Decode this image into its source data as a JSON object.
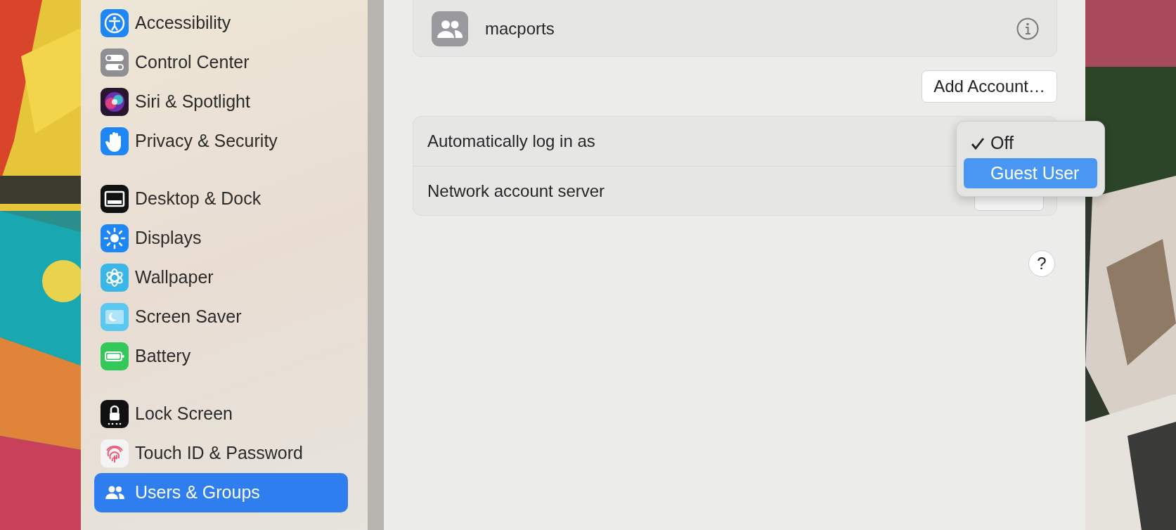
{
  "sidebar": {
    "groups": [
      {
        "items": [
          {
            "label": "Accessibility",
            "selected": false
          },
          {
            "label": "Control Center",
            "selected": false
          },
          {
            "label": "Siri & Spotlight",
            "selected": false
          },
          {
            "label": "Privacy & Security",
            "selected": false
          }
        ]
      },
      {
        "items": [
          {
            "label": "Desktop & Dock",
            "selected": false
          },
          {
            "label": "Displays",
            "selected": false
          },
          {
            "label": "Wallpaper",
            "selected": false
          },
          {
            "label": "Screen Saver",
            "selected": false
          },
          {
            "label": "Battery",
            "selected": false
          }
        ]
      },
      {
        "items": [
          {
            "label": "Lock Screen",
            "selected": false
          },
          {
            "label": "Touch ID & Password",
            "selected": false
          },
          {
            "label": "Users & Groups",
            "selected": true
          }
        ]
      }
    ]
  },
  "accounts": [
    {
      "name": "macports"
    }
  ],
  "add_account_button": "Add Account…",
  "settings_rows": [
    {
      "label": "Automatically log in as"
    },
    {
      "label": "Network account server"
    }
  ],
  "popup_menu": {
    "items": [
      {
        "label": "Off",
        "checked": true,
        "selected": false
      },
      {
        "label": "Guest User",
        "checked": false,
        "selected": true
      }
    ]
  },
  "help_button": "?"
}
